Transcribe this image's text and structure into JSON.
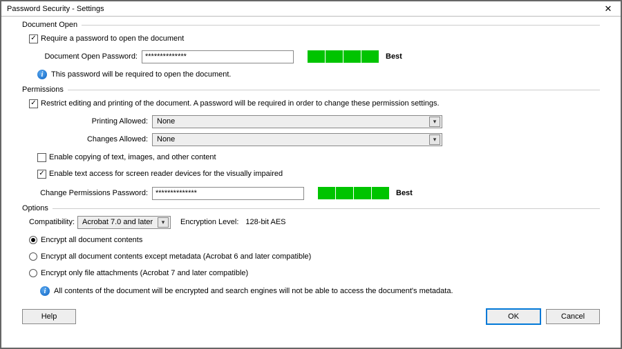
{
  "window": {
    "title": "Password Security - Settings",
    "close": "✕"
  },
  "docopen": {
    "header": "Document Open",
    "require_label": "Require a password to open the document",
    "require_checked": true,
    "pwd_label": "Document Open Password:",
    "pwd_value": "**************",
    "strength": "Best",
    "info": "This password will be required to open the document."
  },
  "perm": {
    "header": "Permissions",
    "restrict_label": "Restrict editing and printing of the document. A password will be required in order to change these permission settings.",
    "restrict_checked": true,
    "printing_label": "Printing Allowed:",
    "printing_value": "None",
    "changes_label": "Changes Allowed:",
    "changes_value": "None",
    "copy_label": "Enable copying of text, images, and other content",
    "copy_checked": false,
    "access_label": "Enable text access for screen reader devices for the visually impaired",
    "access_checked": true,
    "change_pwd_label": "Change Permissions Password:",
    "change_pwd_value": "**************",
    "strength": "Best"
  },
  "options": {
    "header": "Options",
    "compat_label": "Compatibility:",
    "compat_value": "Acrobat 7.0 and later",
    "enc_level_label": "Encryption  Level:",
    "enc_level_value": "128-bit AES",
    "r1": "Encrypt all document contents",
    "r2": "Encrypt all document contents except metadata (Acrobat 6 and later compatible)",
    "r3": "Encrypt only file attachments (Acrobat 7 and later compatible)",
    "selected": 1,
    "info": "All contents of the document will be encrypted and search engines will not be able to access the document's metadata."
  },
  "buttons": {
    "help": "Help",
    "ok": "OK",
    "cancel": "Cancel"
  }
}
